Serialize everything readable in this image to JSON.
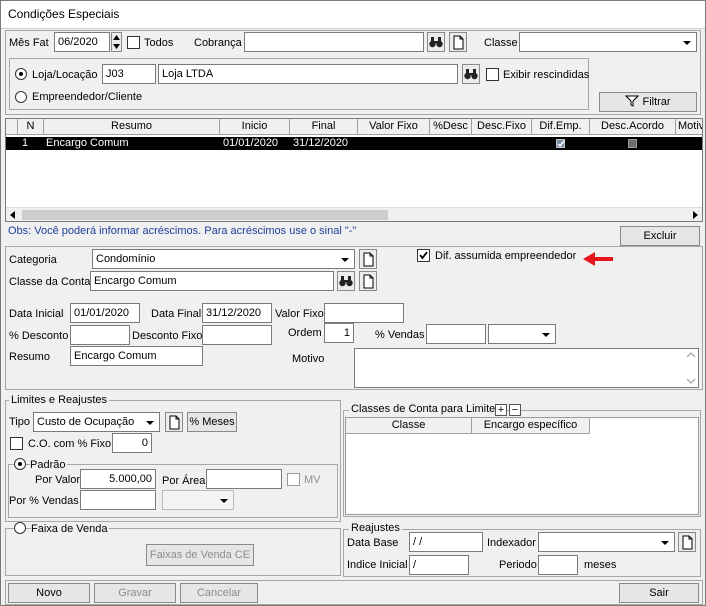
{
  "window": {
    "title": "Condições Especiais"
  },
  "filters": {
    "mes_fat_label": "Mês Fat",
    "mes_fat_value": "06/2020",
    "todos_label": "Todos",
    "cobranca_label": "Cobrança",
    "cobranca_value": "",
    "classe_label": "Classe",
    "classe_value": "",
    "loja_radio_label": "Loja/Locação",
    "loja_code": "J03",
    "loja_name": "Loja LTDA",
    "exibir_rescindidas_label": "Exibir rescindidas",
    "empreendedor_radio_label": "Empreendedor/Cliente",
    "filtrar_label": "Filtrar"
  },
  "grid": {
    "columns": [
      "N",
      "Resumo",
      "Inicio",
      "Final",
      "Valor Fixo",
      "%Desc",
      "Desc.Fixo",
      "Dif.Emp.",
      "Desc.Acordo",
      "Motiv"
    ],
    "rows": [
      {
        "n": "1",
        "resumo": "Encargo Comum",
        "inicio": "01/01/2020",
        "final": "31/12/2020",
        "valor_fixo": "",
        "pct_desc": "",
        "desc_fixo": "",
        "dif_emp": true,
        "desc_acordo": false
      }
    ]
  },
  "obs_text": "Obs: Você poderá informar acréscimos. Para acréscimos use o sinal \"-\"",
  "excluir_label": "Excluir",
  "detail": {
    "categoria_label": "Categoria",
    "categoria_value": "Condomínio",
    "classe_conta_label": "Classe da Conta",
    "classe_conta_value": "Encargo Comum",
    "dif_assumida_label": "Dif. assumida empreendedor",
    "data_inicial_label": "Data Inicial",
    "data_inicial_value": "01/01/2020",
    "data_final_label": "Data Final",
    "data_final_value": "31/12/2020",
    "valor_fixo_label": "Valor Fixo",
    "valor_fixo_value": "",
    "pct_desconto_label": "% Desconto",
    "pct_desconto_value": "",
    "desconto_fixo_label": "Desconto Fixo",
    "desconto_fixo_value": "",
    "ordem_label": "Ordem",
    "ordem_value": "1",
    "pct_vendas_label": "% Vendas",
    "pct_vendas_value": "",
    "resumo_label": "Resumo",
    "resumo_value": "Encargo Comum",
    "motivo_label": "Motivo",
    "motivo_value": ""
  },
  "limites": {
    "title": "Limites e Reajustes",
    "tipo_label": "Tipo",
    "tipo_value": "Custo de Ocupação",
    "pct_meses_label": "% Meses",
    "co_pct_fixo_label": "C.O. com % Fixo",
    "co_pct_fixo_value": "0",
    "padrao_label": "Padrão",
    "por_valor_label": "Por Valor",
    "por_valor_value": "5.000,00",
    "por_area_label": "Por Área",
    "por_area_value": "",
    "mv_label": "MV",
    "por_pct_vendas_label": "Por % Vendas",
    "por_pct_vendas_value": "",
    "faixa_venda_label": "Faixa de Venda",
    "faixas_venda_ce_label": "Faixas de Venda CE"
  },
  "classes_limite": {
    "title": "Classes de Conta para Limite",
    "add": "+",
    "remove": "−",
    "columns": [
      "Classe",
      "Encargo específico"
    ]
  },
  "reajustes": {
    "title": "Reajustes",
    "data_base_label": "Data Base",
    "data_base_value": " /  /",
    "indexador_label": "Indexador",
    "indexador_value": "",
    "indice_inicial_label": "Indice Inicial",
    "indice_inicial_value": " /",
    "periodo_label": "Periodo",
    "periodo_value": "",
    "meses_label": "meses"
  },
  "footer": {
    "novo": "Novo",
    "gravar": "Gravar",
    "cancelar": "Cancelar",
    "sair": "Sair"
  },
  "colors": {
    "annotation_arrow": "#e8141d",
    "selected_row": "#000000",
    "obs_text": "#1e3e9b"
  }
}
